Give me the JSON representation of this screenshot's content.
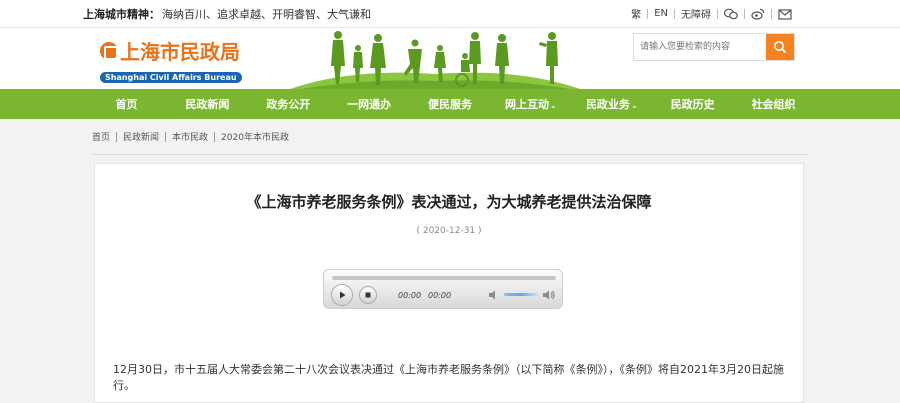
{
  "topbar": {
    "spirit_label": "上海城市精神：",
    "spirit_text": "海纳百川、追求卓越、开明睿智、大气谦和",
    "traditional": "繁",
    "english": "EN",
    "accessibility": "无障碍",
    "icons": [
      "wechat-icon",
      "weibo-icon",
      "mail-icon"
    ]
  },
  "header": {
    "logo_cn": "上海市民政局",
    "logo_en": "Shanghai Civil Affairs Bureau",
    "search_placeholder": "请输入您要检索的内容"
  },
  "nav": {
    "items": [
      {
        "label": "首页"
      },
      {
        "label": "民政新闻"
      },
      {
        "label": "政务公开"
      },
      {
        "label": "一网通办"
      },
      {
        "label": "便民服务"
      },
      {
        "label": "网上互动",
        "dropdown": true
      },
      {
        "label": "民政业务",
        "dropdown": true
      },
      {
        "label": "民政历史"
      },
      {
        "label": "社会组织"
      }
    ]
  },
  "breadcrumb": [
    "首页",
    "民政新闻",
    "本市民政",
    "2020年本市民政"
  ],
  "article": {
    "title": "《上海市养老服务条例》表决通过，为大城养老提供法治保障",
    "date": "( 2020-12-31 )",
    "player": {
      "current_time": "00:00",
      "total_time": "00:00"
    },
    "paragraph1": "12月30日，市十五届人大常委会第二十八次会议表决通过《上海市养老服务条例》（以下简称《条例》），《条例》将自2021年3月20日起施行。"
  },
  "colors": {
    "nav_green": "#7ab630",
    "accent_orange": "#f58220",
    "logo_blue": "#1a66b3"
  }
}
